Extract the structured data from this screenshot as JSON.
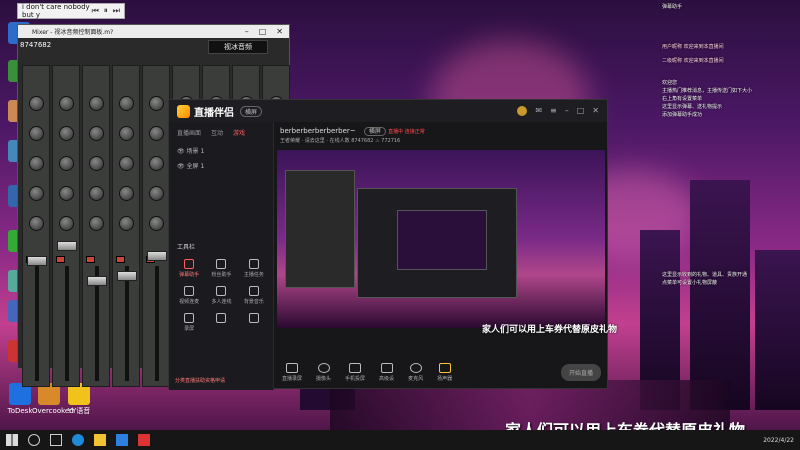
{
  "tooltip": {
    "title": "i don't care nobody but y"
  },
  "mixer": {
    "title": "Mixer - 视冰音频控制面板.m?",
    "badge": "视冰音频"
  },
  "app": {
    "name": "直播伴侣",
    "mode": "横屏",
    "tabs": [
      "直播画面",
      "互动",
      "游戏"
    ],
    "active_tab": "游戏",
    "scenes": [
      "场景 1",
      "全屏 1"
    ],
    "tools_title": "工具栏",
    "tools": [
      "弹幕助手",
      "粉丝助手",
      "主播任务",
      "视频连麦",
      "多人连线",
      "背景音乐",
      "录屏",
      "",
      ""
    ],
    "footer_tip": "分类直播扶助资格申请",
    "room_name": "berberberberberber~",
    "room_tag": "横屏",
    "room_status": "直播中 连接正常",
    "room_sub": [
      "王者荣耀",
      "请去这里",
      "在线人数",
      "8747682",
      "772716"
    ],
    "bottom_tools": [
      "直播录屏",
      "摄像头",
      "手机投屏",
      "高级设",
      "麦克风",
      "扬声器"
    ],
    "start_btn": "开始直播"
  },
  "captions": {
    "overlay": "家人们可以用上车券代替原皮礼物",
    "bottom": "家人们可以用上车券代替原皮礼物"
  },
  "chat": {
    "header": "弹幕助手",
    "lines": [
      "用户昵称  欢迎来到本直播间",
      "二级昵称  欢迎来到本直播间",
      "欢迎您",
      "主播热门推荐消息，主播传送门如下大小",
      "右上角有设置菜单",
      "这里显示弹幕、送礼物提示",
      "添加弹幕助手成功",
      "这里显示收到的礼物、道具、贵族开通",
      "点菜单可设置小礼物屏蔽"
    ]
  },
  "desktop_icons": [
    "ToDesk",
    "Overcooked",
    "YY语音"
  ],
  "mixer_number": "8747682",
  "clock": {
    "time": "",
    "date": "2022/4/22"
  },
  "colors": {
    "accent": "#ff5a5a",
    "brand": "#ffc233"
  }
}
